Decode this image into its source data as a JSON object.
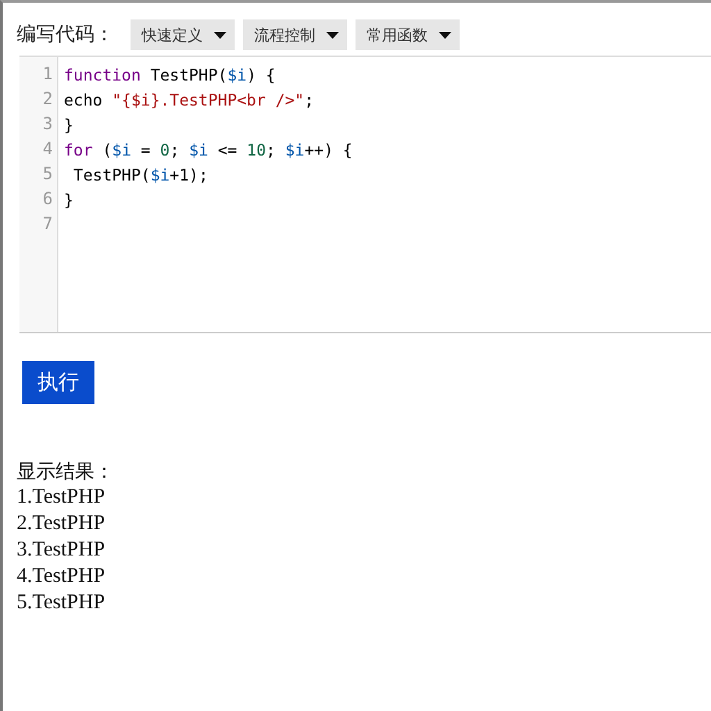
{
  "toolbar": {
    "label": "编写代码：",
    "dropdowns": [
      "快速定义",
      "流程控制",
      "常用函数"
    ]
  },
  "editor": {
    "lines": [
      {
        "number": "1",
        "tokens": [
          {
            "kind": "keyword",
            "text": "function"
          },
          {
            "kind": "plain",
            "text": " TestPHP("
          },
          {
            "kind": "variable",
            "text": "$i"
          },
          {
            "kind": "plain",
            "text": ") {"
          }
        ]
      },
      {
        "number": "2",
        "tokens": [
          {
            "kind": "plain",
            "text": "echo "
          },
          {
            "kind": "string",
            "text": "\"{$i}.TestPHP<br />\""
          },
          {
            "kind": "plain",
            "text": ";"
          }
        ]
      },
      {
        "number": "3",
        "tokens": [
          {
            "kind": "plain",
            "text": "}"
          }
        ]
      },
      {
        "number": "4",
        "tokens": [
          {
            "kind": "keyword",
            "text": "for"
          },
          {
            "kind": "plain",
            "text": " ("
          },
          {
            "kind": "variable",
            "text": "$i"
          },
          {
            "kind": "plain",
            "text": " = "
          },
          {
            "kind": "number",
            "text": "0"
          },
          {
            "kind": "plain",
            "text": "; "
          },
          {
            "kind": "variable",
            "text": "$i"
          },
          {
            "kind": "plain",
            "text": " <= "
          },
          {
            "kind": "number",
            "text": "10"
          },
          {
            "kind": "plain",
            "text": "; "
          },
          {
            "kind": "variable",
            "text": "$i"
          },
          {
            "kind": "plain",
            "text": "++) {"
          }
        ]
      },
      {
        "number": "5",
        "tokens": [
          {
            "kind": "plain",
            "text": " TestPHP("
          },
          {
            "kind": "variable",
            "text": "$i"
          },
          {
            "kind": "plain",
            "text": "+1);"
          }
        ]
      },
      {
        "number": "6",
        "tokens": [
          {
            "kind": "plain",
            "text": "}"
          }
        ]
      },
      {
        "number": "7"
      }
    ]
  },
  "run_button": "执行",
  "result": {
    "label": "显示结果：",
    "lines": [
      "1.TestPHP",
      "2.TestPHP",
      "3.TestPHP",
      "4.TestPHP",
      "5.TestPHP"
    ]
  }
}
